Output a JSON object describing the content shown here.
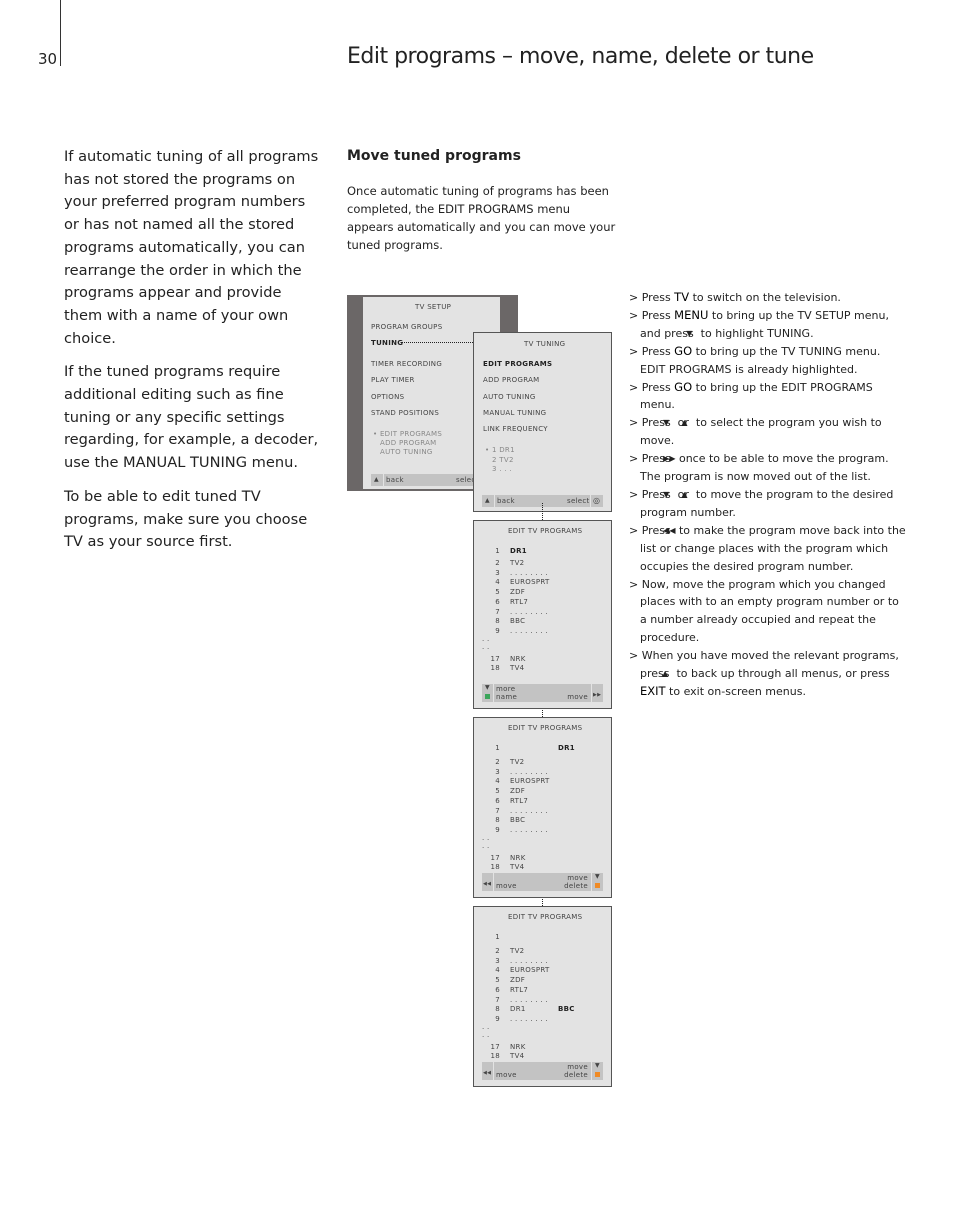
{
  "page_number": "30",
  "title": "Edit programs – move, name, delete or tune",
  "left_paragraphs": [
    "If automatic tuning of all programs has not stored the programs on your preferred program numbers or has not named all the stored programs automatically, you can rearrange the order in which the programs appear and provide them with a name of your own choice.",
    "If the tuned programs require additional editing such as fine tuning or any specific settings regarding, for example, a decoder, use the MANUAL TUNING menu.",
    "To be able to edit tuned TV programs, make sure you choose TV as your source first."
  ],
  "section_heading": "Move tuned programs",
  "intro": "Once automatic tuning of programs has been completed, the EDIT PROGRAMS menu appears automatically and you can move your tuned programs.",
  "colors": {
    "green_button": "#3aa55a",
    "orange_button": "#f08a24",
    "menu_bg": "#e3e3e3",
    "frame": "#6b6767"
  },
  "steps": [
    [
      {
        "t": "Press "
      },
      {
        "k": "TV"
      },
      {
        "t": " to switch on the television."
      }
    ],
    [
      {
        "t": "Press "
      },
      {
        "k": "MENU"
      },
      {
        "t": " to bring up the TV SETUP menu, and press "
      },
      {
        "i": "down-arrow-icon",
        "g": "▼"
      },
      {
        "t": " to highlight TUNING."
      }
    ],
    [
      {
        "t": "Press "
      },
      {
        "k": "GO"
      },
      {
        "t": " to bring up the TV TUNING menu. EDIT PROGRAMS is already highlighted."
      }
    ],
    [
      {
        "t": "Press "
      },
      {
        "k": "GO"
      },
      {
        "t": " to bring up the EDIT PROGRAMS menu."
      }
    ],
    [
      {
        "t": "Press "
      },
      {
        "i": "down-arrow-icon",
        "g": "▼"
      },
      {
        "t": " or "
      },
      {
        "i": "up-arrow-icon",
        "g": "▲"
      },
      {
        "t": " to select the program you wish to move."
      }
    ],
    [
      {
        "t": "Press "
      },
      {
        "i": "fast-forward-icon",
        "g": "▶▶"
      },
      {
        "t": " once to be able to move the program. The program is now moved out of the list."
      }
    ],
    [
      {
        "t": "Press "
      },
      {
        "i": "down-arrow-icon",
        "g": "▼"
      },
      {
        "t": " or "
      },
      {
        "i": "up-arrow-icon",
        "g": "▲"
      },
      {
        "t": " to move the program to the desired program number."
      }
    ],
    [
      {
        "t": "Press "
      },
      {
        "i": "rewind-icon",
        "g": "◀◀"
      },
      {
        "t": " to make the program move back into the list or change places with the program which occupies the desired program number."
      }
    ],
    [
      {
        "t": "Now, move the program which you changed places with to an empty program number or to a number already occupied and repeat the procedure."
      }
    ],
    [
      {
        "t": "When you have moved the relevant programs, press "
      },
      {
        "i": "up-arrow-icon",
        "g": "▲"
      },
      {
        "t": " to back up through all menus, or press "
      },
      {
        "k": "EXIT"
      },
      {
        "t": " to exit on-screen menus."
      }
    ]
  ],
  "tv_setup": {
    "title": "TV  SETUP",
    "items": [
      "PROGRAM  GROUPS",
      "TUNING",
      "TIMER  RECORDING",
      "PLAY  TIMER",
      "OPTIONS",
      "STAND  POSITIONS"
    ],
    "submenu": [
      "•  EDIT  PROGRAMS",
      "ADD PROGRAM",
      "AUTO  TUNING"
    ],
    "back": "back",
    "select": "select"
  },
  "tv_tuning": {
    "title": "TV  TUNING",
    "items": [
      "EDIT  PROGRAMS",
      "ADD  PROGRAM",
      "AUTO  TUNING",
      "MANUAL  TUNING",
      "LINK  FREQUENCY"
    ],
    "preview": [
      "•  1 DR1",
      "2 TV2",
      "3 . . ."
    ],
    "back": "back",
    "select": "select"
  },
  "edit_menus": [
    {
      "title": "EDIT  TV  PROGRAMS",
      "rows": [
        [
          "1",
          "DR1",
          ""
        ],
        [
          "2",
          "TV2",
          ""
        ],
        [
          "3",
          ". . . . . . . .",
          ""
        ],
        [
          "4",
          "EUROSPRT",
          ""
        ],
        [
          "5",
          "ZDF",
          ""
        ],
        [
          "6",
          "RTL7",
          ""
        ],
        [
          "7",
          ". . . . . . . .",
          ""
        ],
        [
          "8",
          "BBC",
          ""
        ],
        [
          "9",
          ". . . . . . . .",
          ""
        ],
        [
          "· ·",
          "",
          ""
        ],
        [
          "· ·",
          "",
          ""
        ],
        [
          "17",
          "NRK",
          ""
        ],
        [
          "18",
          "TV4",
          ""
        ]
      ],
      "bar": {
        "more": "more",
        "name": "name",
        "move": "move"
      }
    },
    {
      "title": "EDIT  TV  PROGRAMS",
      "rows": [
        [
          "1",
          "",
          "DR1"
        ],
        [
          "2",
          "TV2",
          ""
        ],
        [
          "3",
          ". . . . . . . .",
          ""
        ],
        [
          "4",
          "EUROSPRT",
          ""
        ],
        [
          "5",
          "ZDF",
          ""
        ],
        [
          "6",
          "RTL7",
          ""
        ],
        [
          "7",
          ". . . . . . . .",
          ""
        ],
        [
          "8",
          "BBC",
          ""
        ],
        [
          "9",
          ". . . . . . . .",
          ""
        ],
        [
          "· ·",
          "",
          ""
        ],
        [
          "· ·",
          "",
          ""
        ],
        [
          "17",
          "NRK",
          ""
        ],
        [
          "18",
          "TV4",
          ""
        ]
      ],
      "bar": {
        "move_left": "move",
        "move": "move",
        "delete": "delete"
      }
    },
    {
      "title": "EDIT  TV  PROGRAMS",
      "rows": [
        [
          "1",
          "",
          ""
        ],
        [
          "2",
          "TV2",
          ""
        ],
        [
          "3",
          ". . . . . . . .",
          ""
        ],
        [
          "4",
          "EUROSPRT",
          ""
        ],
        [
          "5",
          "ZDF",
          ""
        ],
        [
          "6",
          "RTL7",
          ""
        ],
        [
          "7",
          ". . . . . . . .",
          ""
        ],
        [
          "8",
          "DR1",
          "BBC"
        ],
        [
          "9",
          ". . . . . . . .",
          ""
        ],
        [
          "· ·",
          "",
          ""
        ],
        [
          "· ·",
          "",
          ""
        ],
        [
          "17",
          "NRK",
          ""
        ],
        [
          "18",
          "TV4",
          ""
        ]
      ],
      "bar": {
        "move_left": "move",
        "move": "move",
        "delete": "delete"
      }
    }
  ]
}
